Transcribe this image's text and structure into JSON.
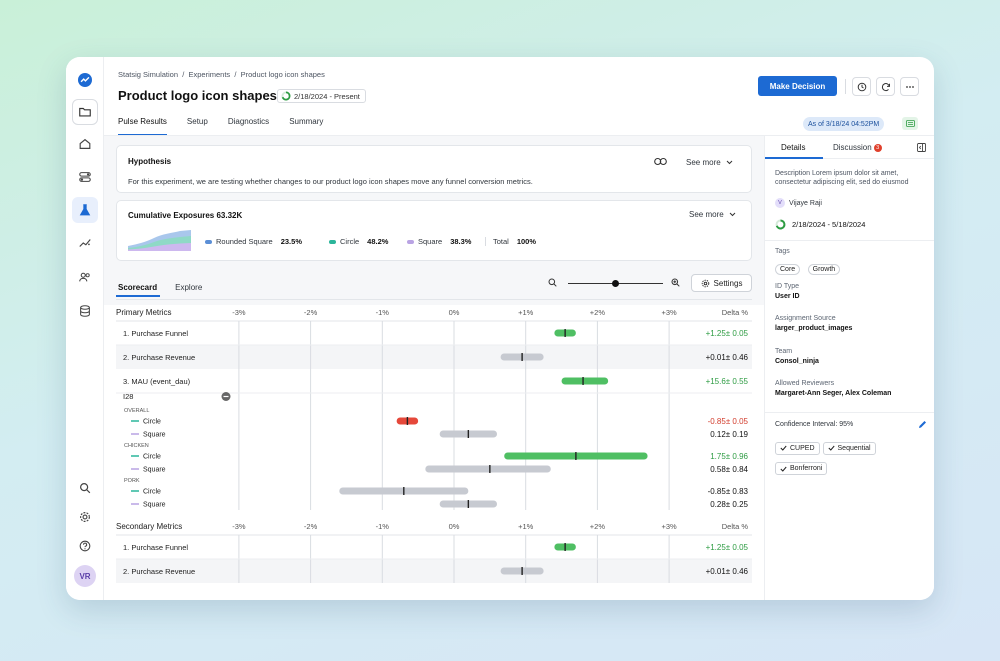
{
  "breadcrumb": [
    "Statsig Simulation",
    "Experiments",
    "Product logo icon shapes"
  ],
  "title": "Product logo icon shapes",
  "date_range": "2/18/2024 - Present",
  "make_decision": "Make Decision",
  "tabs": [
    "Pulse Results",
    "Setup",
    "Diagnostics",
    "Summary"
  ],
  "as_of": "As of 3/18/24 04:52PM",
  "hypothesis": {
    "title": "Hypothesis",
    "see_more": "See more",
    "text": "For this experiment, we are testing whether changes to our product logo icon shapes move any funnel conversion metrics."
  },
  "exposures": {
    "title": "Cumulative Exposures 63.32K",
    "see_more": "See more",
    "groups": [
      {
        "name": "Rounded Square",
        "pct": "23.5%",
        "color": "#5b8fd6"
      },
      {
        "name": "Circle",
        "pct": "48.2%",
        "color": "#2bb59a"
      },
      {
        "name": "Square",
        "pct": "38.3%",
        "color": "#b9a3e3"
      }
    ],
    "total_label": "Total",
    "total_pct": "100%"
  },
  "subtabs": [
    "Scorecard",
    "Explore"
  ],
  "settings": "Settings",
  "ticks": [
    "-3%",
    "-2%",
    "-1%",
    "0%",
    "+1%",
    "+2%",
    "+3%"
  ],
  "delta_header": "Delta %",
  "primary_header": "Primary Metrics",
  "secondary_header": "Secondary Metrics",
  "primary_rows": [
    {
      "kind": "metric",
      "label": "1. Purchase Funnel",
      "lo": 1.4,
      "hi": 1.7,
      "mid": 1.55,
      "color": "#4fbf63",
      "delta": "+1.25± 0.05",
      "delta_color": "#2e9c43",
      "shade": false
    },
    {
      "kind": "metric",
      "label": "2. Purchase Revenue",
      "lo": 0.65,
      "hi": 1.25,
      "mid": 0.95,
      "color": "#c7cad1",
      "delta": "+0.01± 0.46",
      "delta_color": "#111111",
      "shade": true
    },
    {
      "kind": "metric",
      "label": "3. MAU (event_dau)",
      "lo": 1.5,
      "hi": 2.15,
      "mid": 1.8,
      "color": "#4fbf63",
      "delta": "+15.6± 0.55",
      "delta_color": "#2e9c43",
      "shade": false
    },
    {
      "kind": "sub",
      "label": "I28"
    },
    {
      "kind": "group",
      "label": "OVERALL"
    },
    {
      "kind": "series",
      "label": "Circle",
      "line": "#2bb59a",
      "lo": -0.8,
      "hi": -0.5,
      "mid": -0.65,
      "color": "#e5483a",
      "delta": "-0.85± 0.05",
      "delta_color": "#d23b2b"
    },
    {
      "kind": "series",
      "label": "Square",
      "line": "#b9a3e3",
      "lo": -0.2,
      "hi": 0.6,
      "mid": 0.2,
      "color": "#c7cad1",
      "delta": "0.12± 0.19",
      "delta_color": "#111111"
    },
    {
      "kind": "group",
      "label": "CHICKEN"
    },
    {
      "kind": "series",
      "label": "Circle",
      "line": "#2bb59a",
      "lo": 0.7,
      "hi": 2.7,
      "mid": 1.7,
      "color": "#4fbf63",
      "delta": "1.75± 0.96",
      "delta_color": "#2e9c43"
    },
    {
      "kind": "series",
      "label": "Square",
      "line": "#b9a3e3",
      "lo": -0.4,
      "hi": 1.35,
      "mid": 0.5,
      "color": "#c7cad1",
      "delta": "0.58± 0.84",
      "delta_color": "#111111"
    },
    {
      "kind": "group",
      "label": "PORK"
    },
    {
      "kind": "series",
      "label": "Circle",
      "line": "#2bb59a",
      "lo": -1.6,
      "hi": 0.2,
      "mid": -0.7,
      "color": "#c7cad1",
      "delta": "-0.85± 0.83",
      "delta_color": "#111111"
    },
    {
      "kind": "series",
      "label": "Square",
      "line": "#b9a3e3",
      "lo": -0.2,
      "hi": 0.6,
      "mid": 0.2,
      "color": "#c7cad1",
      "delta": "0.28± 0.25",
      "delta_color": "#111111"
    }
  ],
  "secondary_rows": [
    {
      "kind": "metric",
      "label": "1. Purchase Funnel",
      "lo": 1.4,
      "hi": 1.7,
      "mid": 1.55,
      "color": "#4fbf63",
      "delta": "+1.25± 0.05",
      "delta_color": "#2e9c43",
      "shade": false
    },
    {
      "kind": "metric",
      "label": "2. Purchase Revenue",
      "lo": 0.65,
      "hi": 1.25,
      "mid": 0.95,
      "color": "#c7cad1",
      "delta": "+0.01± 0.46",
      "delta_color": "#111111",
      "shade": true
    }
  ],
  "panel": {
    "tabs": [
      "Details",
      "Discussion"
    ],
    "discussion_count": "3",
    "description": "Description Lorem ipsum dolor sit amet, consectetur adipiscing elit, sed do eiusmod",
    "owner_initial": "V",
    "owner": "Vijaye Raji",
    "dates": "2/18/2024 - 5/18/2024",
    "tags_label": "Tags",
    "tags": [
      "Core",
      "Growth"
    ],
    "id_type_label": "ID Type",
    "id_type": "User ID",
    "assignment_label": "Assignment Source",
    "assignment": "larger_product_images",
    "team_label": "Team",
    "team": "Consol_ninja",
    "reviewers_label": "Allowed Reviewers",
    "reviewers": "Margaret-Ann Seger, Alex Coleman",
    "ci_label": "Confidence Interval: 95%",
    "options": [
      "CUPED",
      "Sequential",
      "Bonferroni"
    ]
  },
  "user_initials": "VR"
}
